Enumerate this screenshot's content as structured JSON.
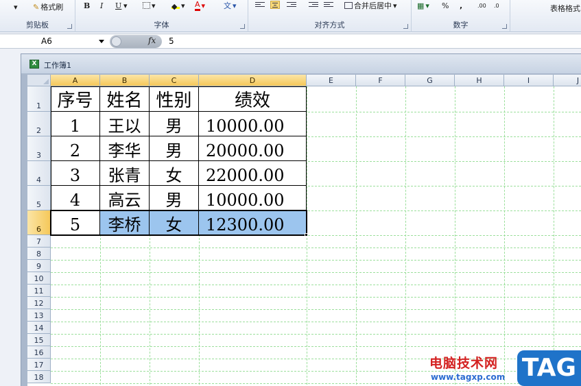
{
  "ribbon": {
    "clipboard": {
      "format_painter": "格式刷",
      "group_label": "剪贴板"
    },
    "font": {
      "bold": "B",
      "italic": "I",
      "underline": "U",
      "font_color_letter": "A",
      "phonetic": "文",
      "group_label": "字体"
    },
    "alignment": {
      "merge_center": "合并后居中",
      "group_label": "对齐方式"
    },
    "number": {
      "percent": "%",
      "comma": ",",
      "group_label": "数字"
    },
    "styles": {
      "table_format": "表格格式"
    }
  },
  "formula_bar": {
    "name_box": "A6",
    "fx": "fx",
    "content": "5"
  },
  "workbook": {
    "title": "工作簿1"
  },
  "columns": [
    "A",
    "B",
    "C",
    "D",
    "E",
    "F",
    "G",
    "H",
    "I",
    "J"
  ],
  "rows": [
    "1",
    "2",
    "3",
    "4",
    "5",
    "6",
    "7",
    "8",
    "9",
    "10",
    "11",
    "12",
    "13",
    "14",
    "15",
    "16",
    "17",
    "18"
  ],
  "table": {
    "headers": [
      "序号",
      "姓名",
      "性别",
      "绩效"
    ],
    "data": [
      [
        "1",
        "王以",
        "男",
        "10000.00"
      ],
      [
        "2",
        "李华",
        "男",
        "20000.00"
      ],
      [
        "3",
        "张青",
        "女",
        "22000.00"
      ],
      [
        "4",
        "高云",
        "男",
        "10000.00"
      ],
      [
        "5",
        "李桥",
        "女",
        "12300.00"
      ]
    ]
  },
  "watermark": {
    "site_name": "电脑技术网",
    "url": "www.tagxp.com",
    "badge": "TAG"
  },
  "colors": {
    "selection_fill": "#9cc5ee",
    "header_highlight": "#f5c85a",
    "gridline": "#9bdf9b"
  }
}
